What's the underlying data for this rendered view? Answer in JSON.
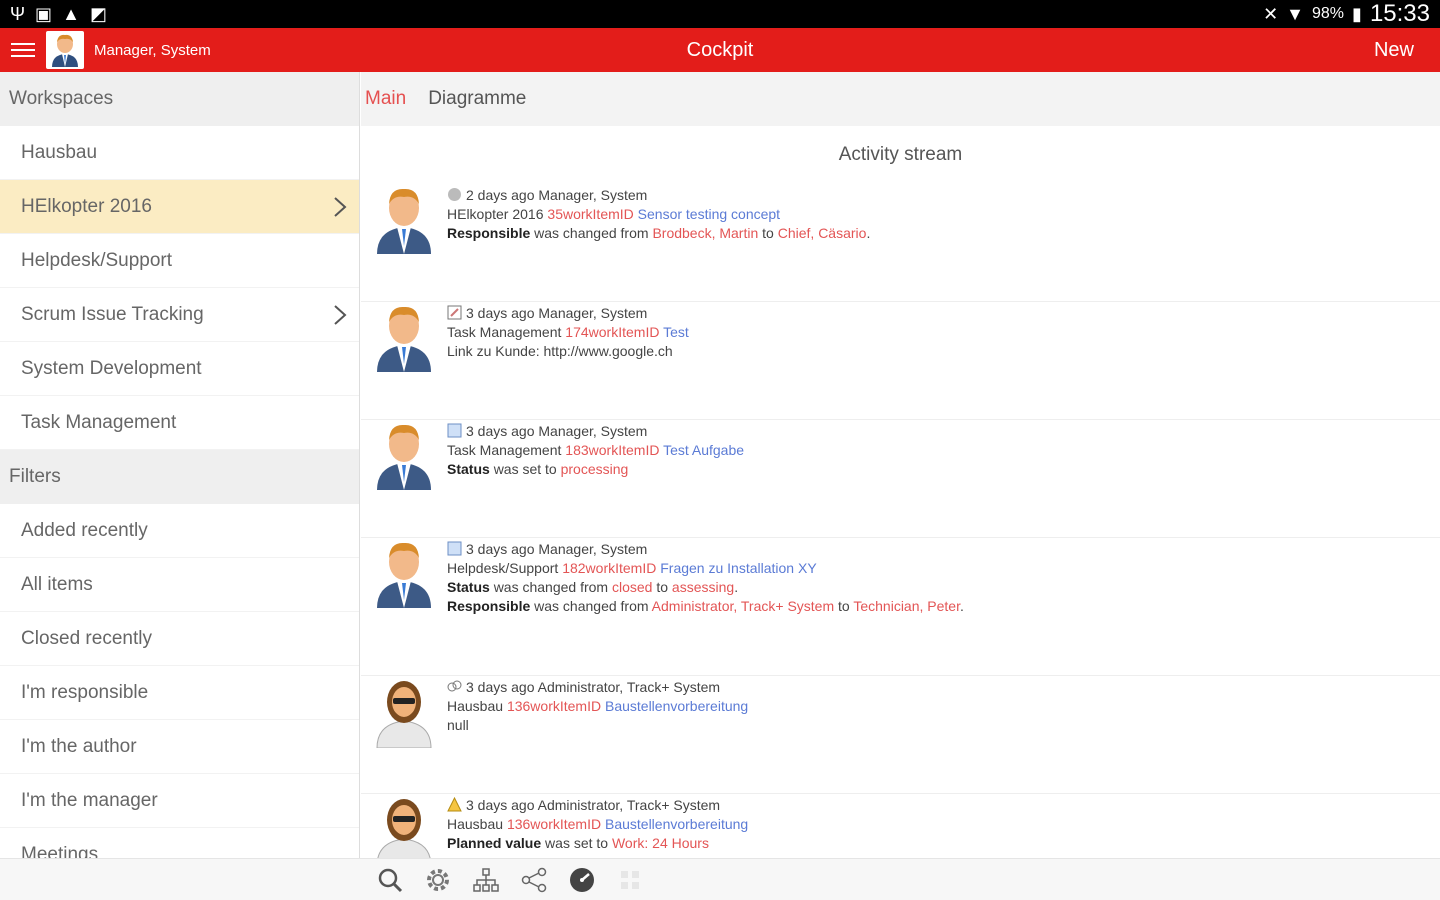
{
  "statusbar": {
    "battery": "98%",
    "time": "15:33"
  },
  "appbar": {
    "user_name": "Manager, System",
    "title": "Cockpit",
    "new_label": "New"
  },
  "sidebar": {
    "workspaces_header": "Workspaces",
    "workspaces": [
      "Hausbau",
      "HElkopter 2016",
      "Helpdesk/Support",
      "Scrum Issue Tracking",
      "System Development",
      "Task Management"
    ],
    "filters_header": "Filters",
    "filters": [
      "Added recently",
      "All items",
      "Closed recently",
      "I'm responsible",
      "I'm the author",
      "I'm the manager",
      "Meetings"
    ]
  },
  "main": {
    "tabs": [
      "Main",
      "Diagramme"
    ],
    "stream_title": "Activity stream",
    "entries": [
      {
        "meta": "2 days ago Manager, System",
        "workspace": "HElkopter 2016",
        "item_id": "35workItemID",
        "item_title": "Sensor testing concept",
        "line1_field": "Responsible",
        "line1_text": "was changed from",
        "line1_from": "Brodbeck, Martin",
        "line1_to_word": "to",
        "line1_to": "Chief, Cäsario",
        "line1_end": "."
      },
      {
        "meta": "3 days ago Manager, System",
        "workspace": "Task Management",
        "item_id": "174workItemID",
        "item_title": "Test",
        "plain": "Link zu Kunde: http://www.google.ch"
      },
      {
        "meta": "3 days ago Manager, System",
        "workspace": "Task Management",
        "item_id": "183workItemID",
        "item_title": "Test Aufgabe",
        "line1_field": "Status",
        "line1_text": "was set to",
        "line1_value": "processing"
      },
      {
        "meta": "3 days ago Manager, System",
        "workspace": "Helpdesk/Support",
        "item_id": "182workItemID",
        "item_title": "Fragen zu Installation XY",
        "line1_field": "Status",
        "line1_text": "was changed from",
        "line1_from": "closed",
        "line1_to_word": "to",
        "line1_to": "assessing",
        "line1_end": ".",
        "line2_field": "Responsible",
        "line2_text": "was changed from",
        "line2_from": "Administrator, Track+ System",
        "line2_to_word": "to",
        "line2_to": "Technician, Peter",
        "line2_end": "."
      },
      {
        "meta": "3 days ago Administrator, Track+ System",
        "workspace": "Hausbau",
        "item_id": "136workItemID",
        "item_title": "Baustellenvorbereitung",
        "plain": "null"
      },
      {
        "meta": "3 days ago Administrator, Track+ System",
        "workspace": "Hausbau",
        "item_id": "136workItemID",
        "item_title": "Baustellenvorbereitung",
        "line1_field": "Planned value",
        "line1_text": "was set to",
        "line1_value": "Work: 24 Hours"
      }
    ]
  },
  "colors": {
    "accent": "#e31d1a",
    "selected_bg": "#fbecc3",
    "link_blue": "#5b7bd5",
    "link_red": "#e35555"
  },
  "icons": {
    "statusbar_left": [
      "usb-icon",
      "image-icon",
      "warning-icon",
      "gallery-icon"
    ],
    "statusbar_right": [
      "mute-icon",
      "wifi-icon",
      "battery-icon"
    ],
    "toolbar": [
      "search-icon",
      "gear-icon",
      "hierarchy-icon",
      "share-icon",
      "dashboard-icon",
      "grid-icon"
    ]
  }
}
